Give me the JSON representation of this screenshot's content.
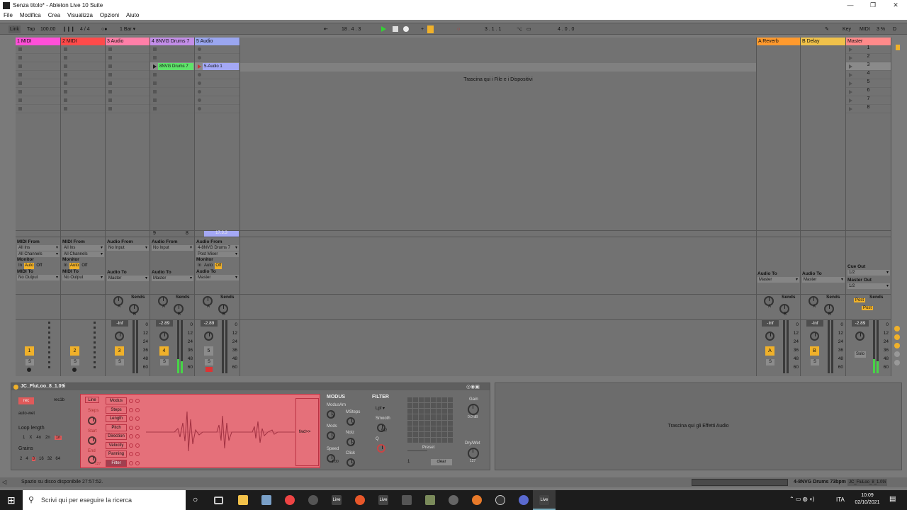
{
  "window": {
    "title": "Senza titolo* - Ableton Live 10 Suite"
  },
  "menu": [
    "File",
    "Modifica",
    "Crea",
    "Visualizza",
    "Opzioni",
    "Aiuto"
  ],
  "control": {
    "link": "Link",
    "tap": "Tap",
    "tempo": "100.00",
    "signature": "4 / 4",
    "quantize": "1 Bar",
    "position": "18 .  4 .  3",
    "loop_start": "3 .  1 .  1",
    "loop_length": "4 .  0 .  0",
    "key": "Key",
    "midi": "MIDI",
    "cpu": "3 %",
    "d": "D"
  },
  "tracks": [
    {
      "name": "1 MIDI",
      "color": "#ff4fd8",
      "num": "1",
      "io_from_label": "MIDI From",
      "from": "All Ins",
      "from2": "All Channels",
      "to_label": "MIDI To",
      "to": "No Output"
    },
    {
      "name": "2 MIDI",
      "color": "#ff4a4a",
      "num": "2",
      "io_from_label": "MIDI From",
      "from": "All Ins",
      "from2": "All Channels",
      "to_label": "MIDI To",
      "to": "No Output"
    },
    {
      "name": "3 Audio",
      "color": "#ff7fa8",
      "num": "3",
      "io_from_label": "Audio From",
      "from": "No Input",
      "from2": "",
      "to_label": "Audio To",
      "to": "Master",
      "vol": "-Inf"
    },
    {
      "name": "4 8NVG Drums 7",
      "color": "#c38ee8",
      "num": "4",
      "io_from_label": "Audio From",
      "from": "No Input",
      "from2": "",
      "to_label": "Audio To",
      "to": "Master",
      "vol": "-2.89",
      "clip": "8NVG Drums 7",
      "clipcolor": "#5fe36a",
      "bottom": "9",
      "bottom2": "8"
    },
    {
      "name": "5 Audio",
      "color": "#9aa6f0",
      "num": "5",
      "io_from_label": "Audio From",
      "from": "4-8NVG Drums 7",
      "from2": "Post Mixer",
      "to_label": "Audio To",
      "to": "Master",
      "vol": "-2.89",
      "clip": "5-Audio 1",
      "clipcolor": "#a4a8f5",
      "bottom": "17.3.3"
    }
  ],
  "returns": [
    {
      "name": "A Reverb",
      "color": "#ff9a2e",
      "letter": "A",
      "to_label": "Audio To",
      "to": "Master",
      "vol": "-Inf"
    },
    {
      "name": "B Delay",
      "color": "#f0c14a",
      "letter": "B",
      "to_label": "Audio To",
      "to": "Master",
      "vol": "-Inf"
    }
  ],
  "master": {
    "name": "Master",
    "color": "#ff8a8a",
    "scenes": [
      "1",
      "2",
      "3",
      "4",
      "5",
      "6",
      "7",
      "8"
    ],
    "cue_label": "Cue Out",
    "cue": "1/2",
    "master_label": "Master Out",
    "master_out": "1/2",
    "vol": "-2.89",
    "post": "Post",
    "solo": "Solo"
  },
  "labels": {
    "monitor": "Monitor",
    "in": "In",
    "auto": "Auto",
    "off": "Off",
    "sends": "Sends",
    "a": "A",
    "b": "B",
    "s": "S",
    "drop_files": "Trascina qui i File e i Dispositivi",
    "drop_fx": "Trascina qui gli Effetti Audio"
  },
  "db": [
    "0",
    "12",
    "24",
    "36",
    "48",
    "60"
  ],
  "device": {
    "title": "JC_FluLoo_8_1.09i",
    "rec": "rec",
    "rec1b": "rec1b",
    "autowet": "auto-wet",
    "loop_length": "Loop length",
    "loop_opts": [
      "1",
      "X",
      "4n",
      "2n",
      "1n"
    ],
    "grains": "Grains",
    "grains_opts": [
      "2",
      "4",
      "8",
      "16",
      "32",
      "64"
    ],
    "line": "Line",
    "mods": [
      "Modus",
      "Steps",
      "Length",
      "Pitch",
      "Direction",
      "Velocity",
      "Panning",
      "Filter"
    ],
    "steps": "Steps",
    "start": "Start",
    "end": "End",
    "end_val": "127",
    "fwd": "fwd>>",
    "modus": "MODUS",
    "modusam": "ModusAm",
    "msteps": "MSteps",
    "mods_label": "Mods",
    "noiz": "Noiz",
    "speed": "Speed",
    "speed_val": "1.00",
    "click": "Click",
    "filter": "FILTER",
    "lpf": "Lpf",
    "smooth": "Smooth",
    "smooth_val": "512",
    "q": "Q",
    "preset": "Preset",
    "clear": "clear",
    "preset_num": "1",
    "gain": "Gain",
    "gain_val": "0.0 dB",
    "drywet": "Dry/Wet",
    "drywet_val": "127",
    "msteps_val": "3",
    "mods_val": "0",
    "noiz_val": "0",
    "click_val": "2",
    "modusam_val": "0"
  },
  "status": {
    "text": "Spazio su disco disponibile 27:57:52.",
    "right": "4-8NVG Drums 73bpm",
    "right2": "JC_FluLoo_8_1.09i"
  },
  "taskbar": {
    "search": "Scrivi qui per eseguire la ricerca",
    "time": "10:09",
    "date": "02/10/2021",
    "lang": "ITA"
  }
}
